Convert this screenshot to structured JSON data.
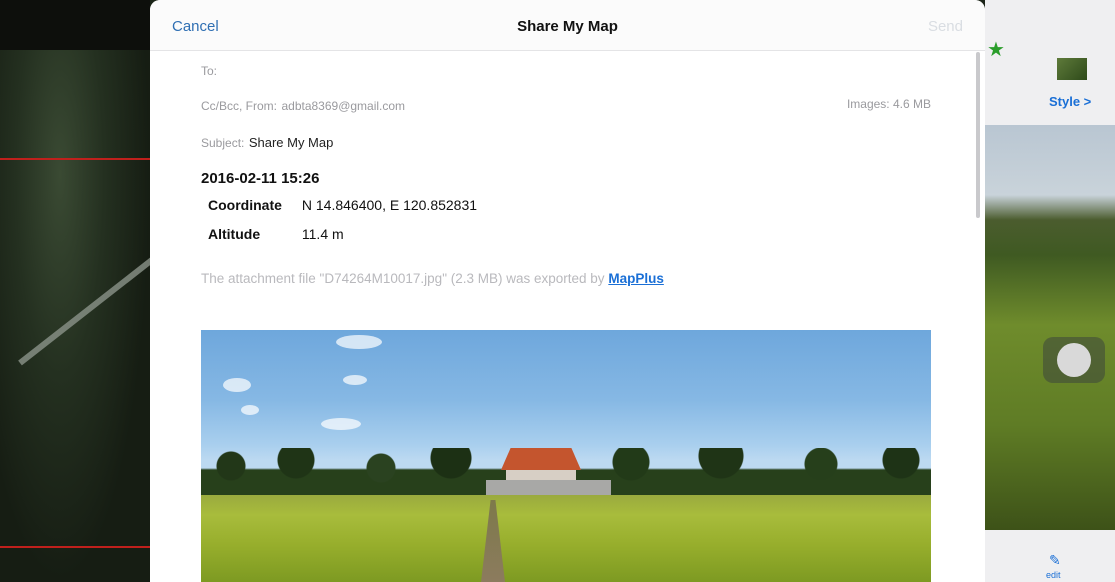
{
  "compose": {
    "cancel_label": "Cancel",
    "title": "Share My Map",
    "send_label": "Send",
    "to_label": "To:",
    "cc_from_label": "Cc/Bcc, From:",
    "from_email": "adbta8369@gmail.com",
    "images_label": "Images:",
    "images_size": "4.6 MB",
    "subject_label": "Subject:",
    "subject_value": "Share My Map"
  },
  "body": {
    "date": "2016-02-11 15:26",
    "coordinate_label": "Coordinate",
    "coordinate_value": "N 14.846400, E 120.852831",
    "altitude_label": "Altitude",
    "altitude_value": "11.4 m",
    "attachment_note": "The attachment file \"D74264M10017.jpg\" (2.3 MB) was exported by",
    "maplus_link": "MapPlus"
  },
  "background_app": {
    "style_label": "Style >",
    "edit_label": "edit"
  },
  "colors": {
    "accent": "#2f6fb3",
    "link": "#1a6fd6"
  }
}
